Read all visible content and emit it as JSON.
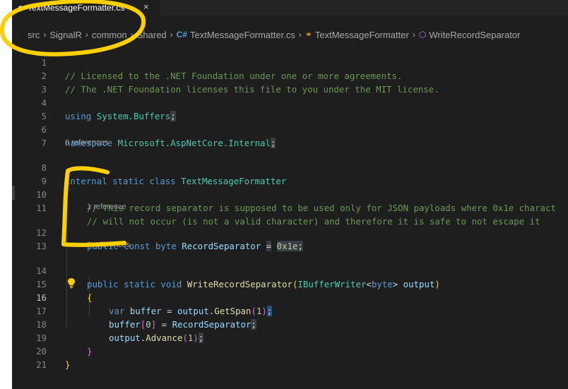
{
  "tab": {
    "title": "TextMessageFormatter.cs",
    "close": "×"
  },
  "breadcrumb": {
    "items": [
      "src",
      "SignalR",
      "common",
      "Shared",
      "TextMessageFormatter.cs",
      "TextMessageFormatter",
      "WriteRecordSeparator"
    ],
    "separator": "›",
    "icons": [
      "csharp-file-icon",
      "class-icon",
      "method-icon"
    ]
  },
  "codelens": {
    "class_refs": "0 references",
    "field_refs": "1 reference",
    "method_refs": "0 references"
  },
  "line_numbers": [
    "1",
    "2",
    "3",
    "4",
    "5",
    "6",
    "7",
    "8",
    "9",
    "10",
    "11",
    "12",
    "13",
    "14",
    "15",
    "16",
    "17",
    "18",
    "19",
    "20",
    "21"
  ],
  "code": {
    "l1": "// Licensed to the .NET Foundation under one or more agreements.",
    "l2": "// The .NET Foundation licenses this file to you under the MIT license.",
    "l4_kw": "using",
    "l4_ns": "System.Buffers",
    "l4_end": ";",
    "l6_kw": "namespace",
    "l6_ns": "Microsoft.AspNetCore.Internal",
    "l6_end": ";",
    "l8_kw": "internal static class",
    "l8_ty": "TextMessageFormatter",
    "l10": "// This record separator is supposed to be used only for JSON payloads where 0x1e charact",
    "l11": "// will not occur (is not a valid character) and therefore it is safe to not escape it",
    "l12_kw": "public const byte",
    "l12_var": "RecordSeparator",
    "l12_eq": "=",
    "l12_num": "0x1e",
    "l12_end": ";",
    "l14_kw": "public static void",
    "l14_fn": "WriteRecordSeparator",
    "l14_p1": "(",
    "l14_ty": "IBufferWriter",
    "l14_lt": "<",
    "l14_kw2": "byte",
    "l14_gt": ">",
    "l14_var": "output",
    "l14_p2": ")",
    "l15": "{",
    "l16_kw": "var",
    "l16_var": "buffer",
    "l16_eq": " = ",
    "l16_obj": "output",
    "l16_dot": ".",
    "l16_fn": "GetSpan",
    "l16_op": "(",
    "l16_num": "1",
    "l16_cp": ")",
    "l16_end": ";",
    "l17_var": "buffer",
    "l17_ob": "[",
    "l17_num": "0",
    "l17_cb": "]",
    "l17_eq": " = ",
    "l17_var2": "RecordSeparator",
    "l17_end": ";",
    "l18_obj": "output",
    "l18_dot": ".",
    "l18_fn": "Advance",
    "l18_op": "(",
    "l18_num": "1",
    "l18_cp": ")",
    "l18_end": ";",
    "l19": "}",
    "l20": "}"
  },
  "colors": {
    "comment": "#6a9955",
    "keyword": "#569cd6",
    "type": "#4ec9b0",
    "function": "#dcdcaa",
    "variable": "#9cdcfe",
    "number": "#b5cea8",
    "annotation": "#ffd000"
  }
}
